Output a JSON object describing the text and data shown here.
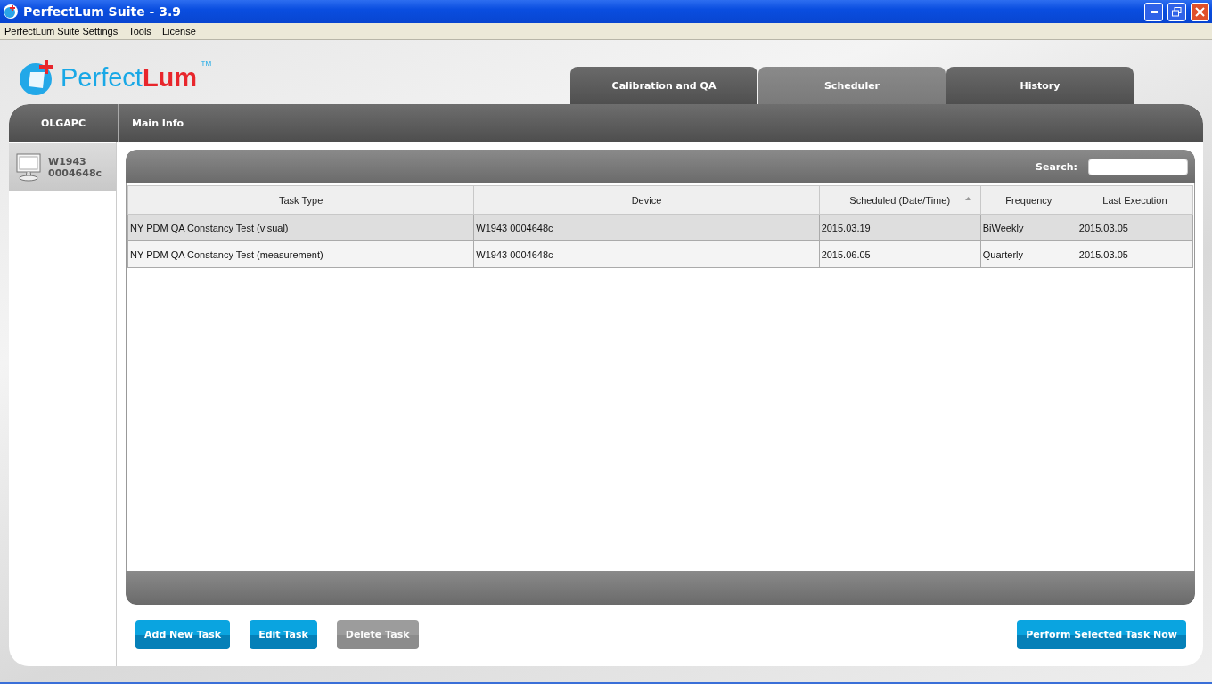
{
  "window": {
    "title": "PerfectLum Suite - 3.9"
  },
  "menu": [
    "PerfectLum Suite Settings",
    "Tools",
    "License"
  ],
  "logo": {
    "first": "Perfect",
    "second": "Lum",
    "trademark": "TM"
  },
  "tabs": [
    {
      "label": "Calibration and QA",
      "selected": false
    },
    {
      "label": "Scheduler",
      "selected": true
    },
    {
      "label": "History",
      "selected": false
    }
  ],
  "sidebar": {
    "header": "OLGAPC",
    "items": [
      {
        "label": "W1943 0004648c",
        "selected": true
      }
    ]
  },
  "section": {
    "title": "Main Info"
  },
  "search": {
    "label": "Search:"
  },
  "table": {
    "columns": [
      {
        "label": "Task Type",
        "sorted": false
      },
      {
        "label": "Device",
        "sorted": false
      },
      {
        "label": "Scheduled (Date/Time)",
        "sorted": true
      },
      {
        "label": "Frequency",
        "sorted": false
      },
      {
        "label": "Last Execution",
        "sorted": false
      }
    ],
    "rows": [
      {
        "selected": true,
        "cells": [
          "NY PDM QA Constancy Test (visual)",
          "W1943 0004648c",
          "2015.03.19",
          "BiWeekly",
          "2015.03.05"
        ]
      },
      {
        "selected": false,
        "cells": [
          "NY PDM QA Constancy Test (measurement)",
          "W1943 0004648c",
          "2015.06.05",
          "Quarterly",
          "2015.03.05"
        ]
      }
    ]
  },
  "buttons": [
    {
      "label": "Add New Task",
      "disabled": false
    },
    {
      "label": "Edit Task",
      "disabled": false
    },
    {
      "label": "Delete Task",
      "disabled": true
    }
  ],
  "primary_button": {
    "label": "Perform Selected Task Now",
    "disabled": false
  }
}
